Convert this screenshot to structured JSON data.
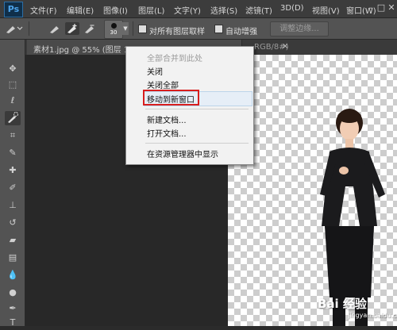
{
  "app": {
    "logo": "Ps"
  },
  "menubar": {
    "items": [
      "文件(F)",
      "编辑(E)",
      "图像(I)",
      "图层(L)",
      "文字(Y)",
      "选择(S)",
      "滤镜(T)",
      "3D(D)",
      "视图(V)",
      "窗口(W)"
    ],
    "window_buttons": [
      "–",
      "□",
      "✕"
    ]
  },
  "options": {
    "brush_size": "30",
    "sample_all_layers": "对所有图层取样",
    "auto_enhance": "自动增强",
    "refine_edge": "调整边缘..."
  },
  "tabs": [
    {
      "title": "素材1.jpg @ 55% (图层 1, ",
      "title_tail": "RGB/8#)",
      "close": "×"
    }
  ],
  "context_menu": {
    "items": [
      {
        "label": "全部合并到此处",
        "disabled": true
      },
      {
        "label": "关闭",
        "disabled": false
      },
      {
        "label": "关闭全部",
        "disabled": false
      },
      {
        "label": "移动到新窗口",
        "disabled": false,
        "highlighted": true
      },
      {
        "label": "新建文档...",
        "disabled": false
      },
      {
        "label": "打开文档...",
        "disabled": false
      },
      {
        "label": "在资源管理器中显示",
        "disabled": false
      }
    ]
  },
  "tools": [
    "move-tool",
    "marquee-tool",
    "lasso-tool",
    "quick-selection-tool",
    "crop-tool",
    "eyedropper-tool",
    "healing-brush-tool",
    "brush-tool",
    "clone-stamp-tool",
    "history-brush-tool",
    "eraser-tool",
    "gradient-tool",
    "blur-tool",
    "dodge-tool",
    "pen-tool",
    "type-tool"
  ],
  "watermark": {
    "text": "Bai 经验",
    "sub": "jingyan.baidu.com"
  },
  "colors": {
    "highlight_red": "#d81e1e",
    "menubar": "#3c3c3c",
    "panel": "#535353"
  }
}
